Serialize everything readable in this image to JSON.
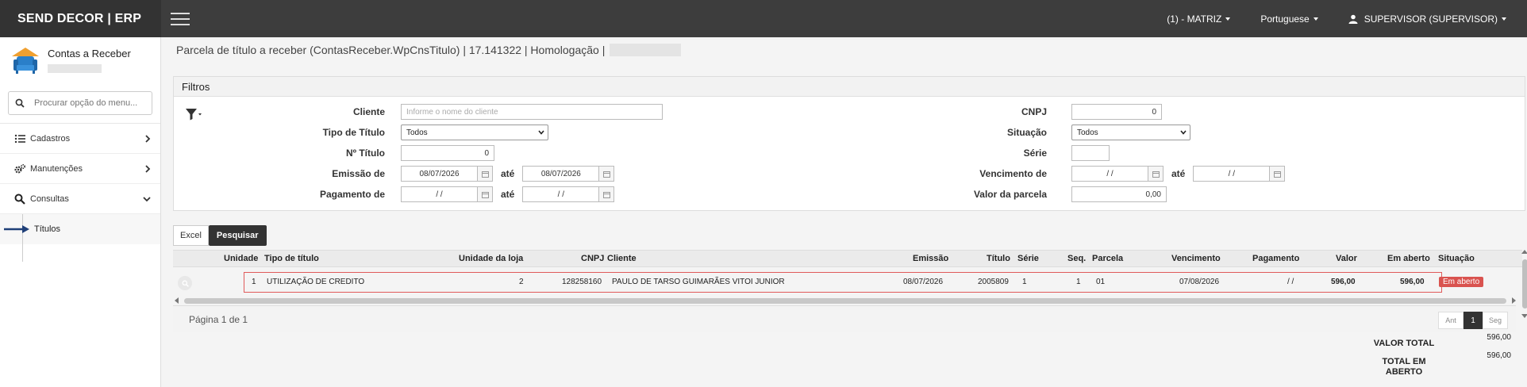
{
  "app": {
    "brand": "SEND DECOR | ERP",
    "unit": "(1) - MATRIZ",
    "language": "Portuguese",
    "user": "SUPERVISOR (SUPERVISOR)"
  },
  "sidebar": {
    "module_title": "Contas a Receber",
    "search_placeholder": "Procurar opção do menu...",
    "items": [
      {
        "label": "Cadastros",
        "icon": "list-icon"
      },
      {
        "label": "Manutenções",
        "icon": "gears-icon"
      },
      {
        "label": "Consultas",
        "icon": "search-icon"
      }
    ],
    "submenu": {
      "label": "Títulos"
    }
  },
  "page": {
    "title": "Parcela de título a receber (ContasReceber.WpCnsTitulo) | 17.141322 | Homologação |"
  },
  "filters": {
    "header": "Filtros",
    "cliente_label": "Cliente",
    "cliente_placeholder": "Informe o nome do cliente",
    "tipo_label": "Tipo de Título",
    "tipo_value": "Todos",
    "numero_label": "Nº Título",
    "numero_value": "0",
    "emissao_label": "Emissão de",
    "emissao_de": "08/07/2026",
    "emissao_ate": "08/07/2026",
    "pagamento_label": "Pagamento de",
    "pagamento_de": "/ /",
    "pagamento_ate": "/ /",
    "cnpj_label": "CNPJ",
    "cnpj_value": "0",
    "situacao_label": "Situação",
    "situacao_value": "Todos",
    "serie_label": "Série",
    "serie_value": "",
    "vencimento_label": "Vencimento de",
    "vencimento_de": "/ /",
    "vencimento_ate": "/ /",
    "valor_label": "Valor da parcela",
    "valor_value": "0,00",
    "ate_label": "até"
  },
  "buttons": {
    "excel": "Excel",
    "pesquisar": "Pesquisar"
  },
  "grid": {
    "columns": [
      "Unidade",
      "Tipo de título",
      "Unidade da loja",
      "CNPJ",
      "Cliente",
      "Emissão",
      "Título",
      "Série",
      "Seq.",
      "Parcela",
      "Vencimento",
      "Pagamento",
      "Valor",
      "Em aberto",
      "Situação"
    ],
    "rows": [
      {
        "unidade": "1",
        "tipo": "UTILIZAÇÃO DE CREDITO",
        "unidade_loja": "2",
        "cnpj": "128258160",
        "cliente": "PAULO DE TARSO GUIMARÃES VITOI JUNIOR",
        "emissao": "08/07/2026",
        "titulo": "2005809",
        "serie": "1",
        "seq": "1",
        "parcela": "01",
        "vencimento": "07/08/2026",
        "pagamento": "/ /",
        "valor": "596,00",
        "em_aberto": "596,00",
        "situacao": "Em aberto"
      }
    ]
  },
  "pager": {
    "text": "Página 1 de 1",
    "prev": "Ant",
    "current": "1",
    "next": "Seg"
  },
  "totals": {
    "valor_total_label": "VALOR TOTAL",
    "valor_total": "596,00",
    "em_aberto_label": "TOTAL EM ABERTO",
    "em_aberto": "596,00"
  },
  "colors": {
    "topbar": "#3d3d3d",
    "accent_dark": "#333333",
    "status_open": "#d9534f",
    "row_highlight": "#e05a5a"
  }
}
